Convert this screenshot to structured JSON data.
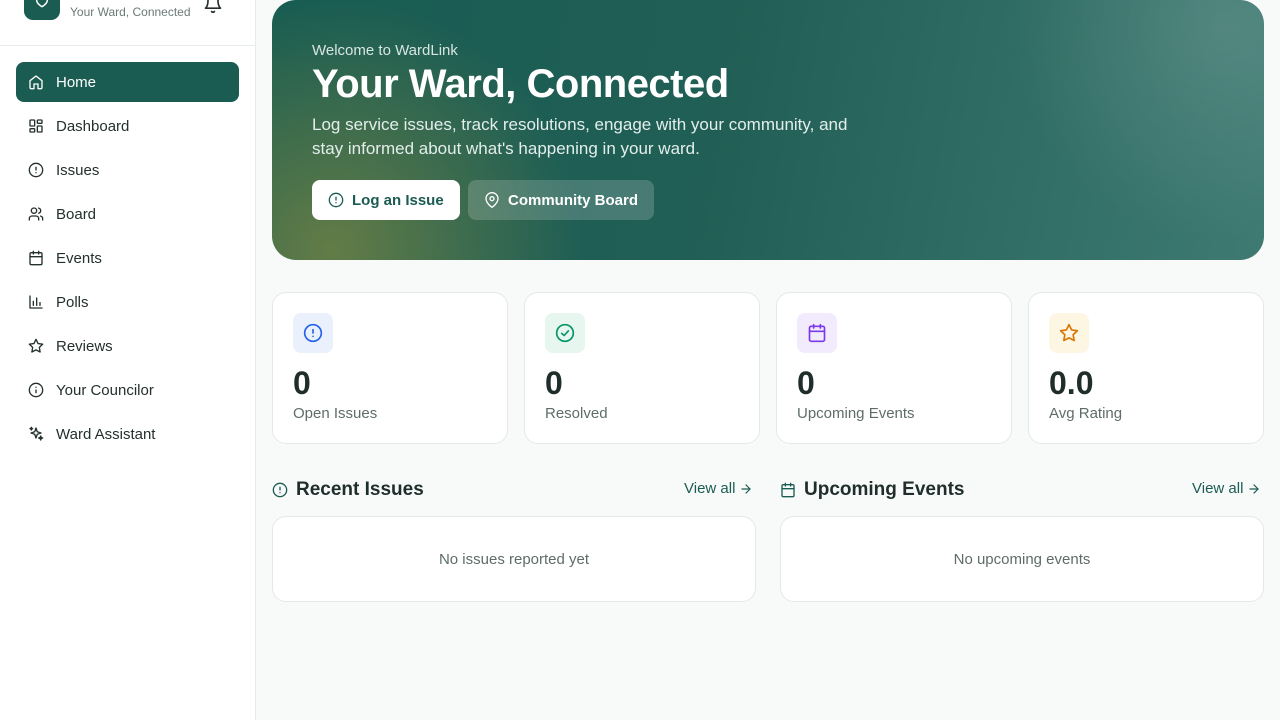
{
  "brand": {
    "tagline": "Your Ward, Connected"
  },
  "sidebar": {
    "items": [
      {
        "label": "Home",
        "icon": "home-icon",
        "active": true
      },
      {
        "label": "Dashboard",
        "icon": "dashboard-icon"
      },
      {
        "label": "Issues",
        "icon": "alert-circle-icon"
      },
      {
        "label": "Board",
        "icon": "users-icon"
      },
      {
        "label": "Events",
        "icon": "calendar-icon"
      },
      {
        "label": "Polls",
        "icon": "bar-chart-icon"
      },
      {
        "label": "Reviews",
        "icon": "star-icon"
      },
      {
        "label": "Your Councilor",
        "icon": "info-icon"
      },
      {
        "label": "Ward Assistant",
        "icon": "sparkle-icon"
      }
    ]
  },
  "hero": {
    "eyebrow": "Welcome to WardLink",
    "title": "Your Ward, Connected",
    "description": "Log service issues, track resolutions, engage with your community, and stay informed about what's happening in your ward.",
    "primary_button": "Log an Issue",
    "secondary_button": "Community Board"
  },
  "stats": [
    {
      "value": "0",
      "label": "Open Issues",
      "icon": "alert-circle-icon",
      "color": "#2563eb",
      "bg": "#eaf1fd"
    },
    {
      "value": "0",
      "label": "Resolved",
      "icon": "check-circle-icon",
      "color": "#059669",
      "bg": "#e7f6ef"
    },
    {
      "value": "0",
      "label": "Upcoming Events",
      "icon": "calendar-icon",
      "color": "#7c3aed",
      "bg": "#f1ebfd"
    },
    {
      "value": "0.0",
      "label": "Avg Rating",
      "icon": "star-icon",
      "color": "#d97706",
      "bg": "#fdf6e3"
    }
  ],
  "recent_issues": {
    "title": "Recent Issues",
    "view_all": "View all",
    "empty": "No issues reported yet"
  },
  "upcoming_events": {
    "title": "Upcoming Events",
    "view_all": "View all",
    "empty": "No upcoming events"
  },
  "colors": {
    "brand": "#1b5c52"
  }
}
